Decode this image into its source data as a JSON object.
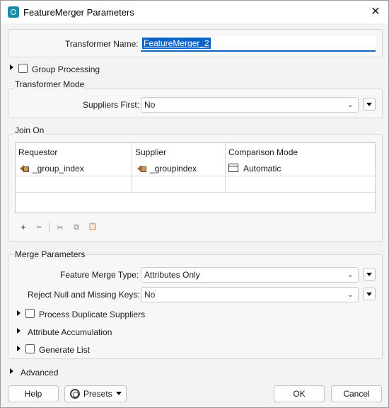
{
  "window": {
    "title": "FeatureMerger Parameters",
    "close_glyph": "✕"
  },
  "transformer": {
    "name_label": "Transformer Name:",
    "name_value": "FeatureMerger_2"
  },
  "group_processing": {
    "label": "Group Processing",
    "checked": false
  },
  "transformer_mode": {
    "section_label": "Transformer Mode",
    "suppliers_first_label": "Suppliers First:",
    "suppliers_first_value": "No"
  },
  "join_on": {
    "section_label": "Join On",
    "columns": [
      "Requestor",
      "Supplier",
      "Comparison Mode"
    ],
    "rows": [
      {
        "requestor": "_group_index",
        "supplier": "_groupindex",
        "comparison_mode": "Automatic"
      }
    ],
    "toolbar": {
      "add": "+",
      "remove": "−",
      "cut": "✂",
      "copy": "⧉",
      "paste": "📋"
    }
  },
  "merge_parameters": {
    "section_label": "Merge Parameters",
    "feature_merge_type_label": "Feature Merge Type:",
    "feature_merge_type_value": "Attributes Only",
    "reject_null_label": "Reject Null and Missing Keys:",
    "reject_null_value": "No",
    "process_duplicate_suppliers_label": "Process Duplicate Suppliers",
    "attribute_accumulation_label": "Attribute Accumulation",
    "generate_list_label": "Generate List"
  },
  "advanced": {
    "label": "Advanced"
  },
  "footer": {
    "help_label": "Help",
    "presets_label": "Presets",
    "ok_label": "OK",
    "cancel_label": "Cancel"
  },
  "colors": {
    "accent": "#1565c0",
    "selection": "#0a64c8",
    "attribute_icon": "#a06a34"
  },
  "icons": [
    "app-icon",
    "close-icon",
    "expand-triangle-icon",
    "attribute-icon",
    "comparison-mode-icon",
    "chevron-down-icon",
    "presets-icon"
  ]
}
